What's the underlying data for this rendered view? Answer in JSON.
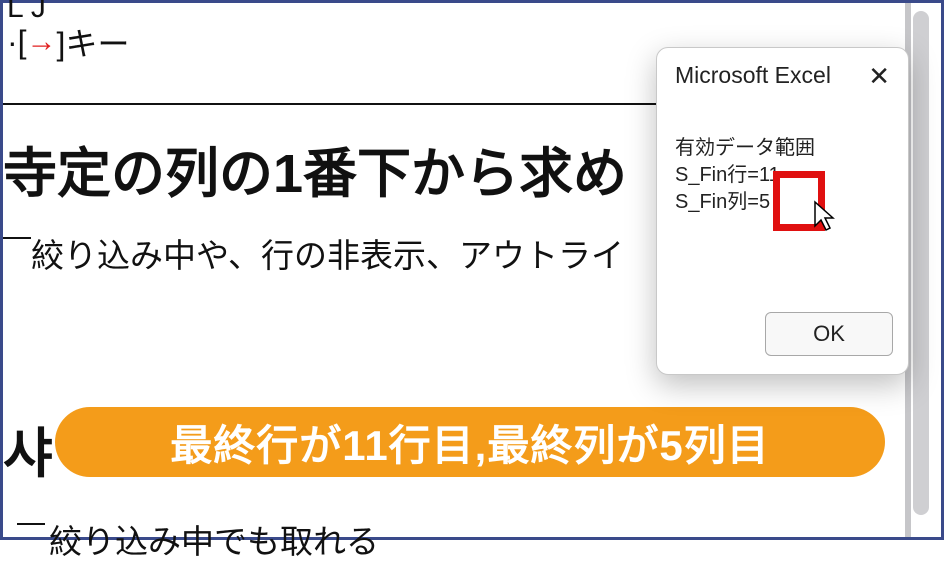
{
  "page": {
    "frag_top": "L J",
    "key_line_prefix": "·[",
    "key_line_arrow": "→",
    "key_line_suffix": "]キー",
    "heading": "寺定の列の1番下から求め",
    "subhead": "絞り込み中や、行の非表示、アウトライ",
    "subhead2": "絞り込み中でも取れる",
    "frag_left": "샤"
  },
  "dialog": {
    "title": "Microsoft Excel",
    "close": "✕",
    "line1": "有効データ範囲",
    "line2_label": "S_Fin行=",
    "line2_value": "11",
    "line3_label": "S_Fin列=",
    "line3_value": "5",
    "ok": "OK"
  },
  "caption": {
    "text": "最終行が11行目,最終列が5列目"
  }
}
